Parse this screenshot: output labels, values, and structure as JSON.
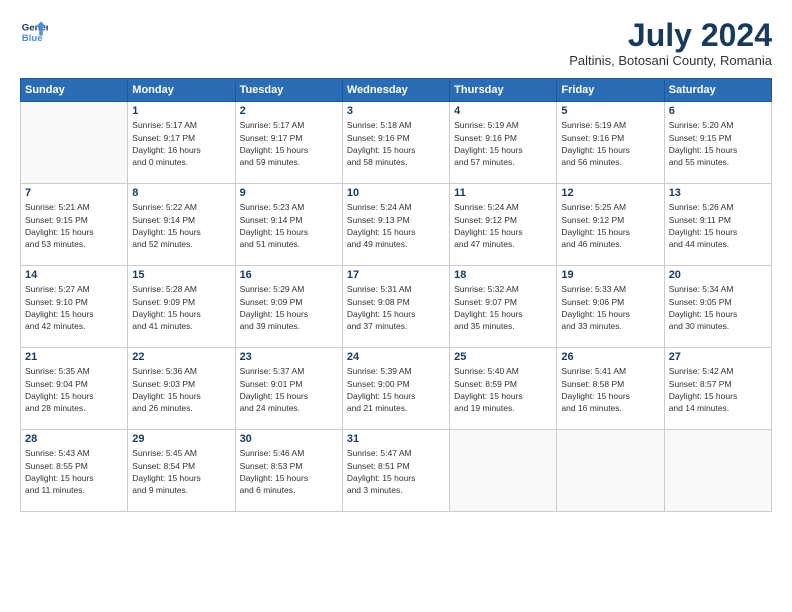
{
  "logo": {
    "line1": "General",
    "line2": "Blue"
  },
  "title": "July 2024",
  "location": "Paltinis, Botosani County, Romania",
  "days_header": [
    "Sunday",
    "Monday",
    "Tuesday",
    "Wednesday",
    "Thursday",
    "Friday",
    "Saturday"
  ],
  "weeks": [
    [
      {
        "num": "",
        "info": ""
      },
      {
        "num": "1",
        "info": "Sunrise: 5:17 AM\nSunset: 9:17 PM\nDaylight: 16 hours\nand 0 minutes."
      },
      {
        "num": "2",
        "info": "Sunrise: 5:17 AM\nSunset: 9:17 PM\nDaylight: 15 hours\nand 59 minutes."
      },
      {
        "num": "3",
        "info": "Sunrise: 5:18 AM\nSunset: 9:16 PM\nDaylight: 15 hours\nand 58 minutes."
      },
      {
        "num": "4",
        "info": "Sunrise: 5:19 AM\nSunset: 9:16 PM\nDaylight: 15 hours\nand 57 minutes."
      },
      {
        "num": "5",
        "info": "Sunrise: 5:19 AM\nSunset: 9:16 PM\nDaylight: 15 hours\nand 56 minutes."
      },
      {
        "num": "6",
        "info": "Sunrise: 5:20 AM\nSunset: 9:15 PM\nDaylight: 15 hours\nand 55 minutes."
      }
    ],
    [
      {
        "num": "7",
        "info": "Sunrise: 5:21 AM\nSunset: 9:15 PM\nDaylight: 15 hours\nand 53 minutes."
      },
      {
        "num": "8",
        "info": "Sunrise: 5:22 AM\nSunset: 9:14 PM\nDaylight: 15 hours\nand 52 minutes."
      },
      {
        "num": "9",
        "info": "Sunrise: 5:23 AM\nSunset: 9:14 PM\nDaylight: 15 hours\nand 51 minutes."
      },
      {
        "num": "10",
        "info": "Sunrise: 5:24 AM\nSunset: 9:13 PM\nDaylight: 15 hours\nand 49 minutes."
      },
      {
        "num": "11",
        "info": "Sunrise: 5:24 AM\nSunset: 9:12 PM\nDaylight: 15 hours\nand 47 minutes."
      },
      {
        "num": "12",
        "info": "Sunrise: 5:25 AM\nSunset: 9:12 PM\nDaylight: 15 hours\nand 46 minutes."
      },
      {
        "num": "13",
        "info": "Sunrise: 5:26 AM\nSunset: 9:11 PM\nDaylight: 15 hours\nand 44 minutes."
      }
    ],
    [
      {
        "num": "14",
        "info": "Sunrise: 5:27 AM\nSunset: 9:10 PM\nDaylight: 15 hours\nand 42 minutes."
      },
      {
        "num": "15",
        "info": "Sunrise: 5:28 AM\nSunset: 9:09 PM\nDaylight: 15 hours\nand 41 minutes."
      },
      {
        "num": "16",
        "info": "Sunrise: 5:29 AM\nSunset: 9:09 PM\nDaylight: 15 hours\nand 39 minutes."
      },
      {
        "num": "17",
        "info": "Sunrise: 5:31 AM\nSunset: 9:08 PM\nDaylight: 15 hours\nand 37 minutes."
      },
      {
        "num": "18",
        "info": "Sunrise: 5:32 AM\nSunset: 9:07 PM\nDaylight: 15 hours\nand 35 minutes."
      },
      {
        "num": "19",
        "info": "Sunrise: 5:33 AM\nSunset: 9:06 PM\nDaylight: 15 hours\nand 33 minutes."
      },
      {
        "num": "20",
        "info": "Sunrise: 5:34 AM\nSunset: 9:05 PM\nDaylight: 15 hours\nand 30 minutes."
      }
    ],
    [
      {
        "num": "21",
        "info": "Sunrise: 5:35 AM\nSunset: 9:04 PM\nDaylight: 15 hours\nand 28 minutes."
      },
      {
        "num": "22",
        "info": "Sunrise: 5:36 AM\nSunset: 9:03 PM\nDaylight: 15 hours\nand 26 minutes."
      },
      {
        "num": "23",
        "info": "Sunrise: 5:37 AM\nSunset: 9:01 PM\nDaylight: 15 hours\nand 24 minutes."
      },
      {
        "num": "24",
        "info": "Sunrise: 5:39 AM\nSunset: 9:00 PM\nDaylight: 15 hours\nand 21 minutes."
      },
      {
        "num": "25",
        "info": "Sunrise: 5:40 AM\nSunset: 8:59 PM\nDaylight: 15 hours\nand 19 minutes."
      },
      {
        "num": "26",
        "info": "Sunrise: 5:41 AM\nSunset: 8:58 PM\nDaylight: 15 hours\nand 16 minutes."
      },
      {
        "num": "27",
        "info": "Sunrise: 5:42 AM\nSunset: 8:57 PM\nDaylight: 15 hours\nand 14 minutes."
      }
    ],
    [
      {
        "num": "28",
        "info": "Sunrise: 5:43 AM\nSunset: 8:55 PM\nDaylight: 15 hours\nand 11 minutes."
      },
      {
        "num": "29",
        "info": "Sunrise: 5:45 AM\nSunset: 8:54 PM\nDaylight: 15 hours\nand 9 minutes."
      },
      {
        "num": "30",
        "info": "Sunrise: 5:46 AM\nSunset: 8:53 PM\nDaylight: 15 hours\nand 6 minutes."
      },
      {
        "num": "31",
        "info": "Sunrise: 5:47 AM\nSunset: 8:51 PM\nDaylight: 15 hours\nand 3 minutes."
      },
      {
        "num": "",
        "info": ""
      },
      {
        "num": "",
        "info": ""
      },
      {
        "num": "",
        "info": ""
      }
    ]
  ]
}
